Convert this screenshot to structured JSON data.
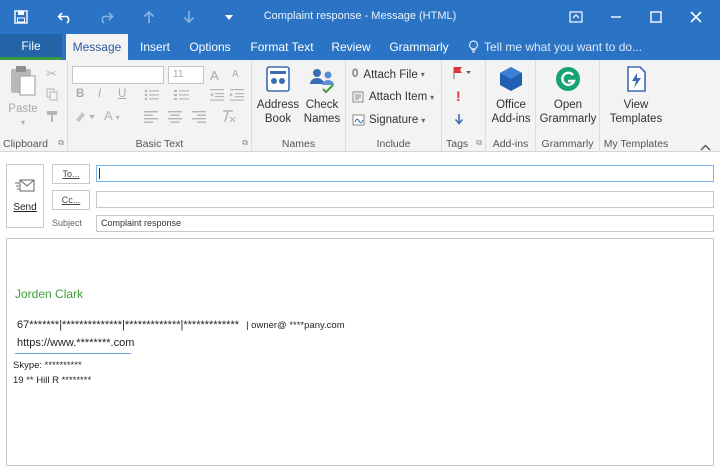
{
  "window": {
    "title": "Complaint response - Message (HTML)"
  },
  "tabs": [
    {
      "label": "File"
    },
    {
      "label": "Message"
    },
    {
      "label": "Insert"
    },
    {
      "label": "Options"
    },
    {
      "label": "Format Text"
    },
    {
      "label": "Review"
    },
    {
      "label": "Grammarly"
    }
  ],
  "tell_me": {
    "placeholder": "Tell me what you want to do..."
  },
  "ribbon": {
    "clipboard": {
      "label": "Clipboard",
      "paste": "Paste"
    },
    "basic_text": {
      "label": "Basic Text",
      "font_size": "11",
      "bold": "B",
      "italic": "I",
      "underline": "U",
      "grow": "A",
      "shrink": "A"
    },
    "names": {
      "label": "Names",
      "address_book": [
        "Address",
        "Book"
      ],
      "check_names": [
        "Check",
        "Names"
      ]
    },
    "include": {
      "label": "Include",
      "attach_file": "Attach File",
      "attach_item": "Attach Item",
      "signature": "Signature"
    },
    "tags": {
      "label": "Tags"
    },
    "addins": {
      "label": "Add-ins",
      "office_addins": [
        "Office",
        "Add-ins"
      ]
    },
    "grammarly": {
      "label": "Grammarly",
      "open": [
        "Open",
        "Grammarly"
      ]
    },
    "my_templates": {
      "label": "My Templates",
      "view": [
        "View",
        "Templates"
      ]
    }
  },
  "compose": {
    "send_label": "Send",
    "to_label": "To...",
    "cc_label": "Cc...",
    "subject_label": "Subject",
    "to_value": "",
    "cc_value": "",
    "subject_value": "Complaint response"
  },
  "body": {
    "signature_name": "Jorden Clark",
    "phone_line": "67*******|**************|*************|*************",
    "email_line": "| owner@ ****pany.com",
    "website": "https://www.********.com",
    "skype": "Skype:   **********",
    "address": "19 **  Hill R ********"
  },
  "colors": {
    "title_bar": "#2b74c5",
    "file_tab_accent": "#3a9b45",
    "signature_green": "#3f9a3a",
    "ribbon_bg": "#f3f3f3"
  }
}
